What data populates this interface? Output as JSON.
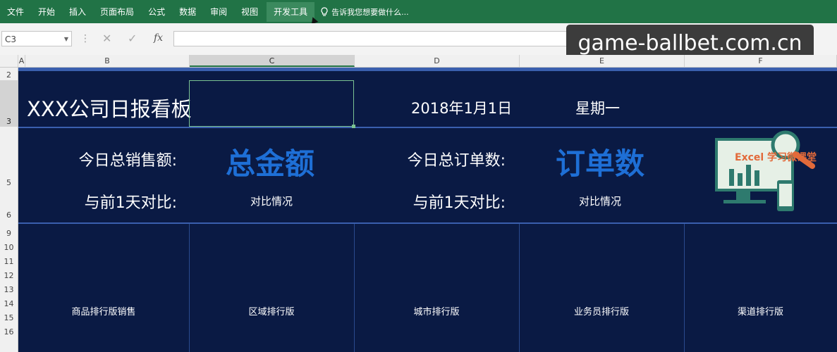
{
  "ribbon": {
    "tabs": [
      "文件",
      "开始",
      "插入",
      "页面布局",
      "公式",
      "数据",
      "审阅",
      "视图",
      "开发工具"
    ],
    "active_tab": "开发工具",
    "tell_me": "告诉我您想要做什么..."
  },
  "formula_bar": {
    "name_box": "C3",
    "fx_label": "fx",
    "content": ""
  },
  "watermark": "game-ballbet.com.cn",
  "columns": [
    "A",
    "B",
    "C",
    "D",
    "E",
    "F"
  ],
  "selected_column": "C",
  "rows": [
    "2",
    "3",
    "5",
    "6",
    "9",
    "10",
    "11",
    "12",
    "13",
    "14",
    "15",
    "16"
  ],
  "selected_row": "3",
  "dashboard": {
    "title": "XXX公司日报看板",
    "date": "2018年1月1日",
    "weekday": "星期一",
    "sales_label": "今日总销售额:",
    "sales_value": "总金额",
    "sales_compare_label": "与前1天对比:",
    "sales_compare_value": "对比情况",
    "orders_label": "今日总订单数:",
    "orders_value": "订单数",
    "orders_compare_label": "与前1天对比:",
    "orders_compare_value": "对比情况",
    "logo_text": "Excel 学习微课堂",
    "rankings": [
      "商品排行版销售",
      "区域排行版",
      "城市排行版",
      "业务员排行版",
      "渠道排行版"
    ]
  },
  "colors": {
    "ribbon": "#217346",
    "dashboard_bg": "#0a1a44",
    "accent_blue": "#1e6fd6",
    "divider": "#3a5fae"
  }
}
